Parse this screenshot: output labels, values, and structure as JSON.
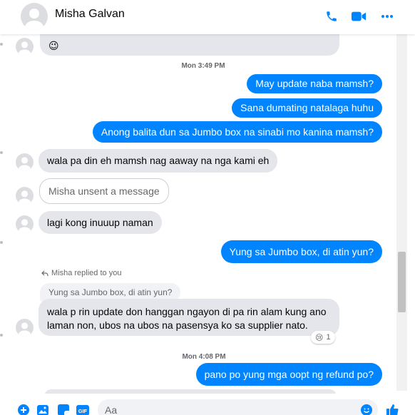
{
  "header": {
    "contact_name": "Misha Galvan",
    "icons": [
      "phone-icon",
      "video-camera-icon",
      "more-options-icon"
    ],
    "accent_color": "#0084ff"
  },
  "messages": {
    "m0_partial_emoji": "😉",
    "timestamp_1": "Mon 3:49 PM",
    "m1": "May update naba mamsh?",
    "m2": "Sana dumating natalaga huhu",
    "m3": "Anong balita dun sa Jumbo box na sinabi mo kanina mamsh?",
    "m4": "wala pa din eh mamsh nag aaway na nga kami eh",
    "m5_unsent": "Misha unsent a message",
    "m6": "lagi kong inuuup naman",
    "m7": "Yung sa Jumbo box, di atin yun?",
    "replied_label": "Misha replied to you",
    "quoted_text": "Yung sa Jumbo box, di atin yun?",
    "m8_line1": "wala p rin update don hanggan ngayon di pa rin alam kung ano",
    "m8_line2": "laman non, ubos na ubos na pasensya ko sa supplier nato.",
    "m8_reaction_emoji": "😢",
    "m8_reaction_count": "1",
    "timestamp_2": "Mon 4:08 PM",
    "m9": "pano po yung mga oopt ng refund po?"
  },
  "composer": {
    "placeholder": "Aa",
    "icons": [
      "plus-icon",
      "image-icon",
      "sticker-icon",
      "gif-icon",
      "emoji-icon",
      "like-icon"
    ],
    "gif_label": "GIF"
  }
}
